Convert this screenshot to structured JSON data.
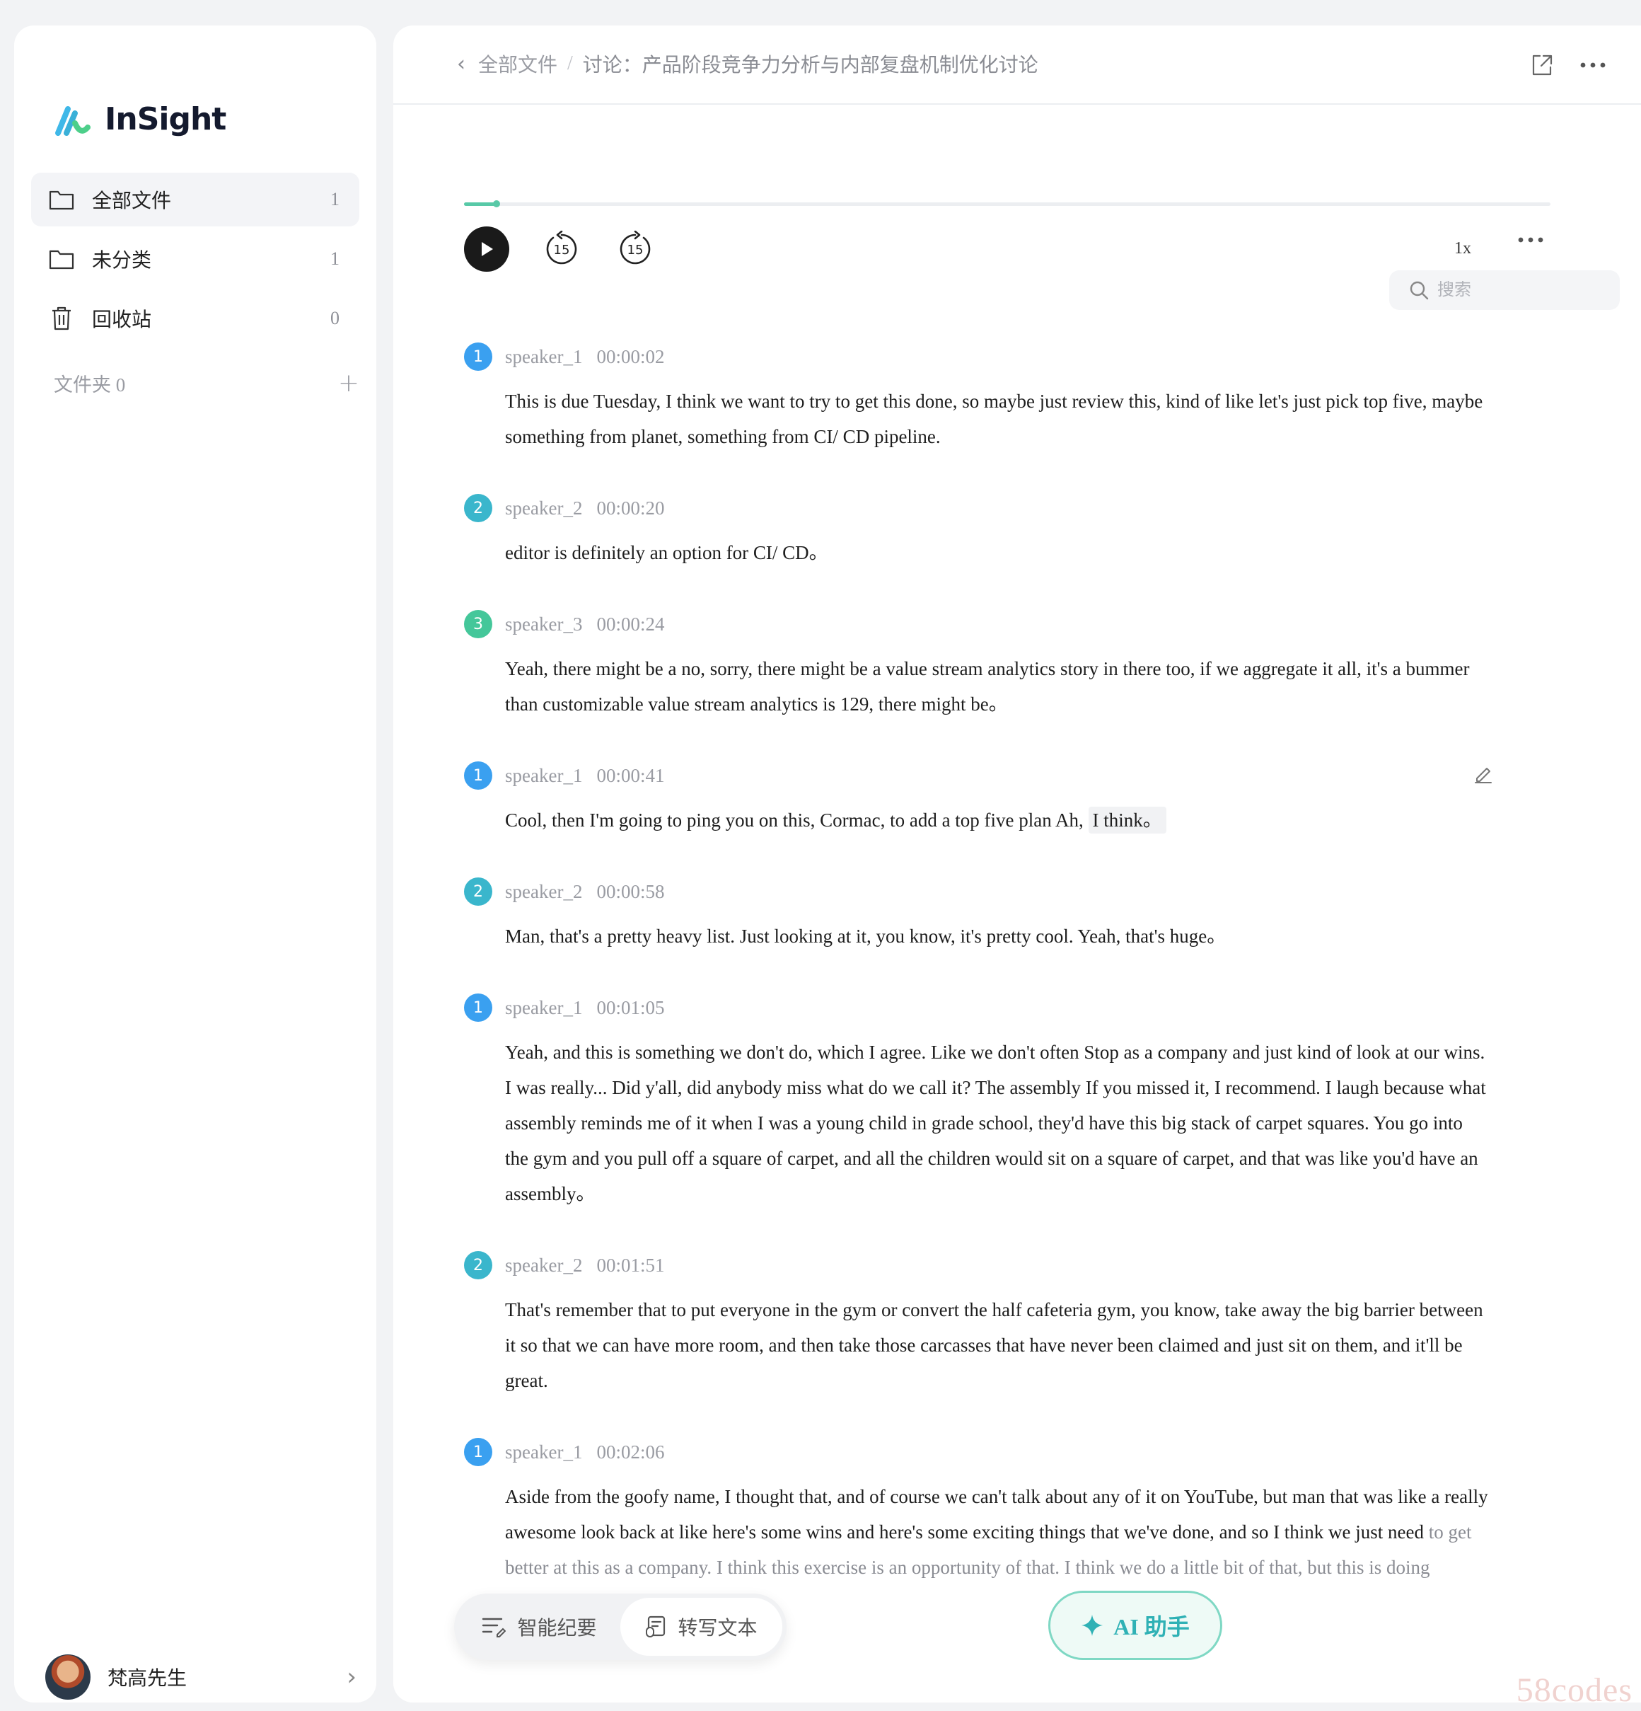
{
  "app": {
    "name": "InSight"
  },
  "sidebar": {
    "items": [
      {
        "label": "全部文件",
        "count": "1",
        "icon": "folder-icon"
      },
      {
        "label": "未分类",
        "count": "1",
        "icon": "folder-icon"
      },
      {
        "label": "回收站",
        "count": "0",
        "icon": "trash-icon"
      }
    ],
    "folders_label": "文件夹 0",
    "add_folder": "+",
    "user": {
      "name": "梵高先生"
    }
  },
  "header": {
    "breadcrumb_root": "全部文件",
    "breadcrumb_sep": "/",
    "breadcrumb_current": "讨论：产品阶段竞争力分析与内部复盘机制优化讨论"
  },
  "player": {
    "progress": 0.03,
    "skip_back": "15",
    "skip_forward": "15",
    "speed": "1x"
  },
  "search": {
    "placeholder": "搜索"
  },
  "transcript": [
    {
      "speaker_num": "1",
      "speaker": "speaker_1",
      "time": "00:00:02",
      "color": "#3aa0f0",
      "text": "This is due Tuesday, I think we want to try to get this done, so maybe just review this, kind of like let's just pick top five, maybe something from planet, something from CI/ CD pipeline."
    },
    {
      "speaker_num": "2",
      "speaker": "speaker_2",
      "time": "00:00:20",
      "color": "#3ab6cc",
      "text": "editor is definitely an option for CI/ CD。"
    },
    {
      "speaker_num": "3",
      "speaker": "speaker_3",
      "time": "00:00:24",
      "color": "#44c79a",
      "text": "Yeah, there might be a no, sorry, there might be a value stream analytics story in there too, if we aggregate it all, it's a bummer than customizable value stream analytics is 129, there might be。"
    },
    {
      "speaker_num": "1",
      "speaker": "speaker_1",
      "time": "00:00:41",
      "color": "#3aa0f0",
      "text": "Cool, then I'm going to ping you on this, Cormac, to add a top five plan Ah,",
      "highlight": "I think。"
    },
    {
      "speaker_num": "2",
      "speaker": "speaker_2",
      "time": "00:00:58",
      "color": "#3ab6cc",
      "text": "Man, that's a pretty heavy list. Just looking at it, you know, it's pretty cool. Yeah, that's huge。"
    },
    {
      "speaker_num": "1",
      "speaker": "speaker_1",
      "time": "00:01:05",
      "color": "#3aa0f0",
      "text": "Yeah, and this is something we don't do, which I agree. Like we don't often Stop as a company and just kind of look at our wins. I was really... Did y'all, did anybody miss what do we call it? The assembly If you missed it, I recommend. I laugh because what assembly reminds me of it when I was a young child in grade school, they'd have this big stack of carpet squares. You go into the gym and you pull off a square of carpet, and all the children would sit on a square of carpet, and that was like you'd have an assembly。"
    },
    {
      "speaker_num": "2",
      "speaker": "speaker_2",
      "time": "00:01:51",
      "color": "#3ab6cc",
      "text": "That's remember that to put everyone in the gym or convert the half cafeteria gym, you know, take away the big barrier between it so that we can have more room, and then take those carcasses that have never been claimed and just sit on them, and it'll be great."
    },
    {
      "speaker_num": "1",
      "speaker": "speaker_1",
      "time": "00:02:06",
      "color": "#3aa0f0",
      "text": "Aside from the goofy name, I thought that, and of course we can't talk about any of it on YouTube, but man that was like a really awesome look back at like here's some wins and here's some exciting things that we've done, and so I think we just need",
      "text_faded": "to get better at this as a company. I think this exercise is an opportunity of that. I think we do a little bit of that, but this is doing"
    }
  ],
  "bottom_tabs": [
    {
      "label": "智能纪要",
      "icon": "summary-icon"
    },
    {
      "label": "转写文本",
      "icon": "transcript-icon"
    }
  ],
  "ai_button": {
    "label": "AI 助手"
  },
  "watermark": "58codes",
  "colors": {
    "accent": "#58c9a7",
    "ai_border": "#7fd8c4",
    "ai_text": "#2fb1b5"
  }
}
